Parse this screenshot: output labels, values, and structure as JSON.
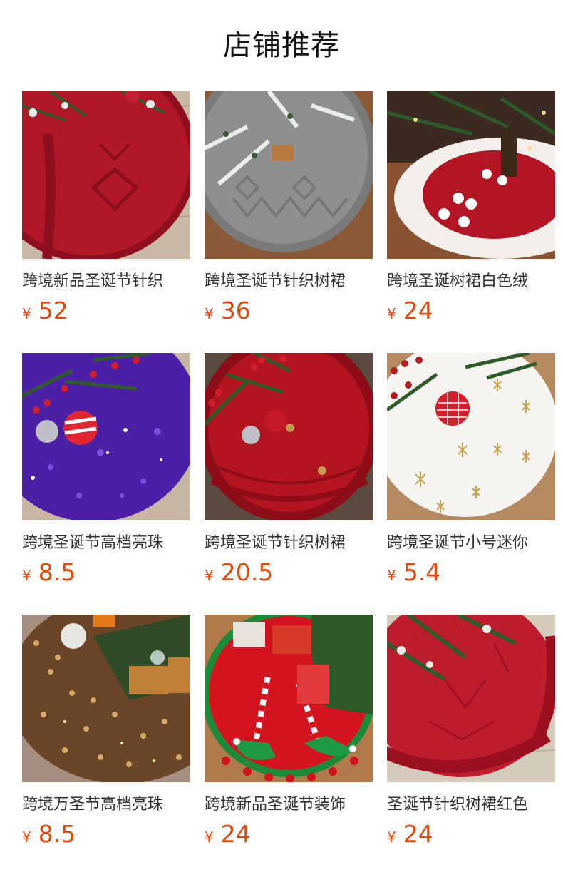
{
  "header": {
    "title": "店铺推荐"
  },
  "colors": {
    "price": "#e8470c",
    "title": "#111111",
    "text": "#333333"
  },
  "products": [
    {
      "name": "跨境新品圣诞节针织",
      "currency": "¥",
      "price": "52",
      "image": "red-knit-tree-skirt"
    },
    {
      "name": "跨境圣诞节针织树裙",
      "currency": "¥",
      "price": "36",
      "image": "gray-knit-tree-skirt"
    },
    {
      "name": "跨境圣诞树裙白色绒",
      "currency": "¥",
      "price": "24",
      "image": "red-white-plush-tree-skirt"
    },
    {
      "name": "跨境圣诞节高档亮珠",
      "currency": "¥",
      "price": "8.5",
      "image": "purple-sequin-tree-skirt"
    },
    {
      "name": "跨境圣诞节针织树裙",
      "currency": "¥",
      "price": "20.5",
      "image": "red-button-knit-tree-skirt"
    },
    {
      "name": "跨境圣诞节小号迷你",
      "currency": "¥",
      "price": "5.4",
      "image": "white-snowflake-tree-skirt"
    },
    {
      "name": "跨境万圣节高档亮珠",
      "currency": "¥",
      "price": "8.5",
      "image": "gold-sequin-tree-skirt"
    },
    {
      "name": "跨境新品圣诞节装饰",
      "currency": "¥",
      "price": "24",
      "image": "elf-legs-tree-skirt"
    },
    {
      "name": "圣诞节针织树裙红色",
      "currency": "¥",
      "price": "24",
      "image": "red-cable-knit-tree-skirt"
    }
  ]
}
